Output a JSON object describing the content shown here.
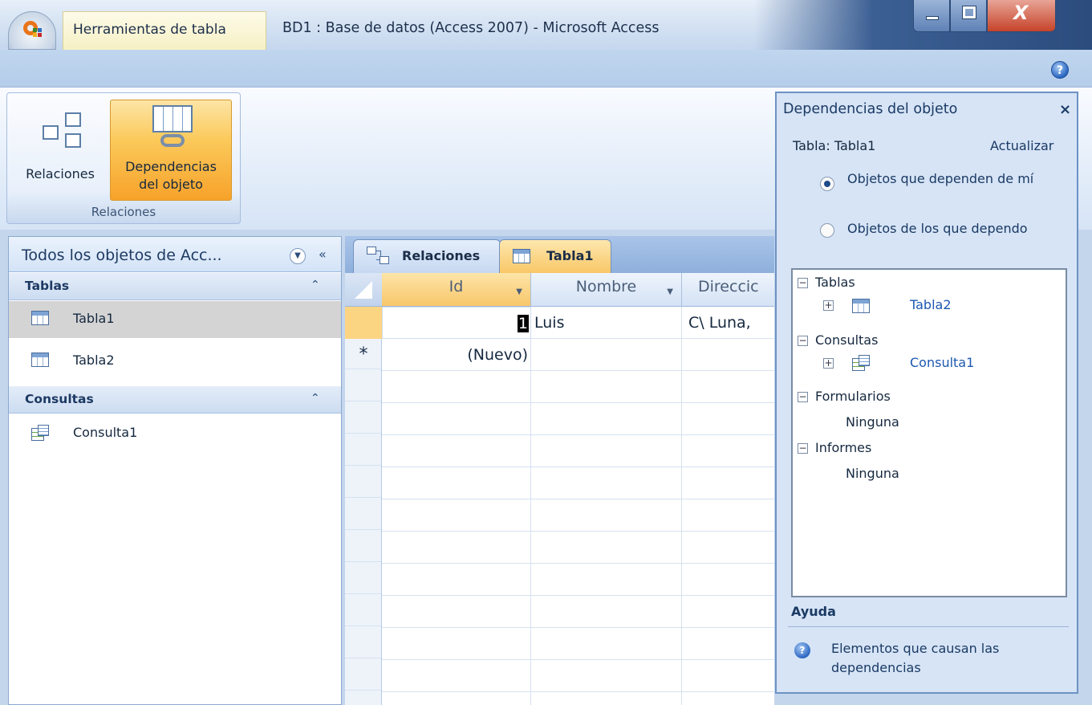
{
  "titlebar": {
    "context_tab": "Herramientas de tabla",
    "app_title": "BD1 : Base de datos (Access 2007) - Microsoft Access",
    "close_glyph": "X"
  },
  "ribbon": {
    "help_glyph": "?",
    "group_label": "Relaciones",
    "relaciones_label": "Relaciones",
    "dependencias_label_line1": "Dependencias",
    "dependencias_label_line2": "del objeto"
  },
  "nav": {
    "header": "Todos los objetos de Acc...",
    "collapse_glyph": "«",
    "sections": [
      {
        "title": "Tablas",
        "items": [
          "Tabla1",
          "Tabla2"
        ]
      },
      {
        "title": "Consultas",
        "items": [
          "Consulta1"
        ]
      }
    ]
  },
  "doc": {
    "tabs": [
      "Relaciones",
      "Tabla1"
    ],
    "columns": [
      "Id",
      "Nombre",
      "Direccic"
    ],
    "row1": {
      "id": "1",
      "nombre": "Luis",
      "direccion": "C\\ Luna,"
    },
    "new_row_marker": "*",
    "new_row_label": "(Nuevo)"
  },
  "dependencies": {
    "title": "Dependencias del objeto",
    "close_glyph": "×",
    "object": "Tabla: Tabla1",
    "refresh": "Actualizar",
    "option_depend_on_me": "Objetos que dependen de mí",
    "option_i_depend_on": "Objetos de los que dependo",
    "tree": {
      "tablas": "Tablas",
      "tabla2": "Tabla2",
      "consultas": "Consultas",
      "consulta1": "Consulta1",
      "formularios": "Formularios",
      "formularios_none": "Ninguna",
      "informes": "Informes",
      "informes_none": "Ninguna"
    },
    "help_section": "Ayuda",
    "help_link": "Elementos que causan las dependencias"
  },
  "icons": {
    "office_button": "office-logo-icon",
    "help": "help-icon",
    "table": "table-icon",
    "query": "query-icon",
    "relationships": "relationships-icon"
  },
  "colors": {
    "selected_tab": "#f9c767",
    "panel_blue": "#d6e4f6",
    "link_blue": "#1d58b0"
  }
}
